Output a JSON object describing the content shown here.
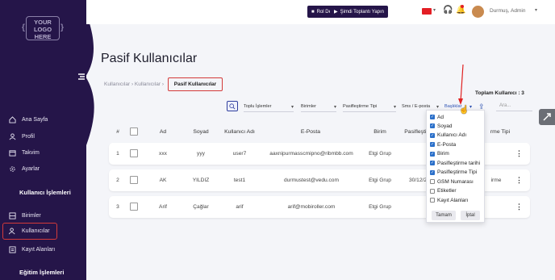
{
  "logo": {
    "line1": "YOUR",
    "line2": "LOGO",
    "line3": "HERE"
  },
  "sidebar": {
    "items": [
      {
        "label": "Ana Sayfa",
        "icon": "home-icon"
      },
      {
        "label": "Profil",
        "icon": "user-icon"
      },
      {
        "label": "Takvim",
        "icon": "calendar-icon"
      },
      {
        "label": "Ayarlar",
        "icon": "gear-icon"
      }
    ],
    "section1": "Kullanıcı İşlemleri",
    "items2": [
      {
        "label": "Birimler",
        "icon": "units-icon"
      },
      {
        "label": "Kullanıcılar",
        "icon": "users-icon"
      },
      {
        "label": "Kayıt Alanları",
        "icon": "form-icon"
      }
    ],
    "section2": "Eğitim İşlemleri"
  },
  "topbar": {
    "role_btn": "Rol Değiştir",
    "meet_btn": "Şimdi Toplantı Yapın",
    "user": "Durmuş, Admin",
    "colors": {
      "bg": "#251549"
    }
  },
  "page": {
    "title": "Pasif Kullanıcılar",
    "breadcrumb": "Kullanıcılar › Kullanıcılar ›",
    "breadcrumb_active": "Pasif Kullanıcılar",
    "total": "Toplam Kullanıcı : 3"
  },
  "toolbar": {
    "bulk": "Toplu İşlemler",
    "units": "Birimler",
    "deact": "Pasifleştirme Tipi",
    "sms": "Sms / E-posta",
    "headers": "Başlıklar",
    "search_placeholder": "Ara..."
  },
  "table": {
    "headers": {
      "num": "#",
      "ad": "Ad",
      "soyad": "Soyad",
      "user": "Kullanıcı Adı",
      "email": "E-Posta",
      "birim": "Birim",
      "pdate": "Pasifleştir",
      "ptype": "rme Tipi"
    },
    "rows": [
      {
        "num": "1",
        "ad": "xxx",
        "soyad": "yyy",
        "user": "user7",
        "email": "aaxnipurmasscmipno@ribmbb.com",
        "birim": "Etgi Grup",
        "pdate": "",
        "ptype": ""
      },
      {
        "num": "2",
        "ad": "AK",
        "soyad": "YILDIZ",
        "user": "test1",
        "email": "durmustest@vedu.com",
        "birim": "Etgi Grup",
        "pdate": "30/12/2",
        "ptype": "irme"
      },
      {
        "num": "3",
        "ad": "Arif",
        "soyad": "Çağlar",
        "user": "arif",
        "email": "arif@mobiroller.com",
        "birim": "Etgi Grup",
        "pdate": "",
        "ptype": ""
      }
    ]
  },
  "dropdown": {
    "options": [
      {
        "label": "Ad",
        "checked": true
      },
      {
        "label": "Soyad",
        "checked": true
      },
      {
        "label": "Kullanıcı Adı",
        "checked": true
      },
      {
        "label": "E-Posta",
        "checked": true
      },
      {
        "label": "Birim",
        "checked": true
      },
      {
        "label": "Pasifleştirme tarihi",
        "checked": true
      },
      {
        "label": "Pasifleştirme Tipi",
        "checked": true
      },
      {
        "label": "GSM Numarası",
        "checked": false
      },
      {
        "label": "Etiketler",
        "checked": false
      },
      {
        "label": "Kayıt Alanları",
        "checked": false
      }
    ],
    "ok": "Tamam",
    "cancel": "İptal"
  }
}
